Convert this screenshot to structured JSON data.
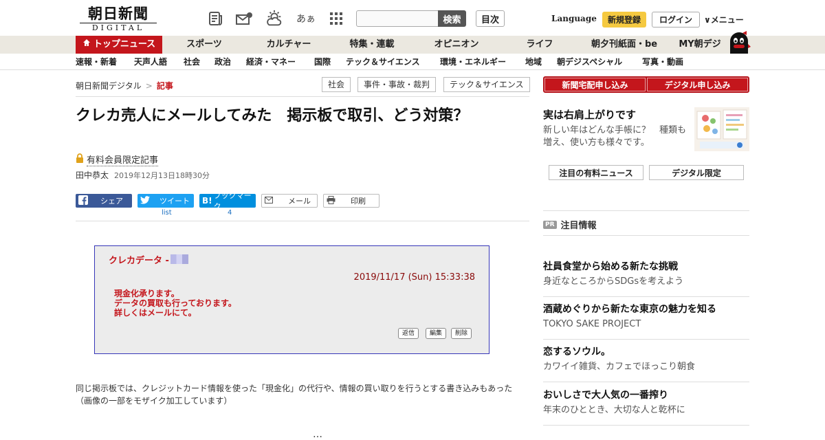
{
  "header": {
    "logo_main": "朝日新聞",
    "logo_sub": "DIGITAL",
    "search_placeholder": "",
    "search_label": "検索",
    "toc_label": "目次",
    "language_label": "Language",
    "register_label": "新規登録",
    "login_label": "ログイン",
    "menu_label": "∨メニュー",
    "hiragana_icon_text": "あぁ"
  },
  "nav_primary": [
    "トップニュース",
    "スポーツ",
    "カルチャー",
    "特集・連載",
    "オピニオン",
    "ライフ",
    "朝夕刊紙面・be",
    "MY朝デジ"
  ],
  "nav_secondary": [
    "速報・新着",
    "天声人語",
    "社会",
    "政治",
    "経済・マネー",
    "国際",
    "テック＆サイエンス",
    "環境・エネルギー",
    "地域",
    "朝デジスペシャル",
    "写真・動画"
  ],
  "breadcrumb": {
    "home": "朝日新聞デジタル",
    "sep": ">",
    "current": "記事"
  },
  "tags": [
    "社会",
    "事件・事故・裁判",
    "テック＆サイエンス"
  ],
  "article": {
    "title": "クレカ売人にメールしてみた　掲示板で取引、どう対策？",
    "paid_label": "有料会員限定記事",
    "author": "田中恭太",
    "date": "2019年12月13日18時30分",
    "share": {
      "facebook": "シェア",
      "twitter": "ツイート",
      "hatena": "ブックマーク",
      "mail": "メール",
      "print": "印刷",
      "twitter_count": "list",
      "hatena_count": "4"
    },
    "figure": {
      "heading": "クレカデータ -",
      "datetime": "2019/11/17 (Sun) 15:33:38",
      "body": [
        "現金化承ります。",
        "データの買取も行っております。",
        "詳しくはメールにて。"
      ],
      "buttons": [
        "返信",
        "編集",
        "削除"
      ]
    },
    "caption": "同じ掲示板では、クレジットカード情報を使った「現金化」の代行や、情報の買い取りを行うとする書き込みもあった（画像の一部をモザイク加工しています）"
  },
  "sidebar": {
    "buttons": [
      "新聞宅配申し込み",
      "デジタル申し込み"
    ],
    "ad": {
      "title": "実は右肩上がりです",
      "text": "新しい年はどんな手帳に？　種類も増え、使い方も様々です。"
    },
    "tabs": [
      "注目の有料ニュース",
      "デジタル限定"
    ],
    "pr_badge": "PR",
    "pr_label": "注目情報",
    "items": [
      {
        "title": "社員食堂から始める新たな挑戦",
        "sub": "身近なところからSDGsを考えよう"
      },
      {
        "title": "酒蔵めぐりから新たな東京の魅力を知る",
        "sub": "TOKYO SAKE PROJECT"
      },
      {
        "title": "恋するソウル。",
        "sub": "カワイイ雑貨、カフェでほっこり朝食"
      },
      {
        "title": "おいしさで大人気の一番搾り",
        "sub": "年末のひととき、大切な人と乾杯に"
      }
    ]
  },
  "colors": {
    "brand_red": "#c4161c",
    "nav_bg": "#ebe8e0",
    "register_yellow": "#f5c940",
    "figure_border": "#3535b8"
  }
}
